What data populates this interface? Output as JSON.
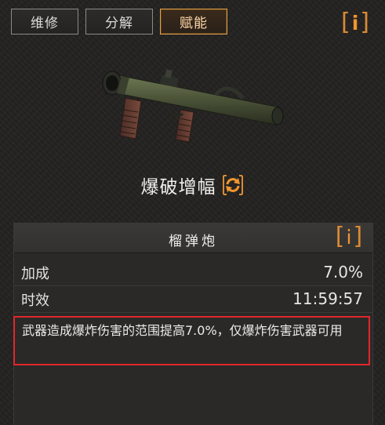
{
  "tabs": [
    {
      "label": "维修",
      "active": false
    },
    {
      "label": "分解",
      "active": false
    },
    {
      "label": "赋能",
      "active": true
    }
  ],
  "info_button": {
    "left_bracket": "[",
    "glyph": "i",
    "right_bracket": "]"
  },
  "weapon": {
    "icon": "rocket-launcher-icon"
  },
  "enhancement": {
    "title": "爆破增幅",
    "reroll_icon": "refresh-icon"
  },
  "panel": {
    "title": "榴弹炮",
    "stats": [
      {
        "label": "加成",
        "value": "7.0%"
      },
      {
        "label": "时效",
        "value": "11:59:57"
      }
    ],
    "description": "武器造成爆炸伤害的范围提高7.0%，仅爆炸伤害武器可用"
  },
  "colors": {
    "accent_orange": "#e08c2e",
    "highlight_red": "#e2262b",
    "background": "#232221"
  }
}
